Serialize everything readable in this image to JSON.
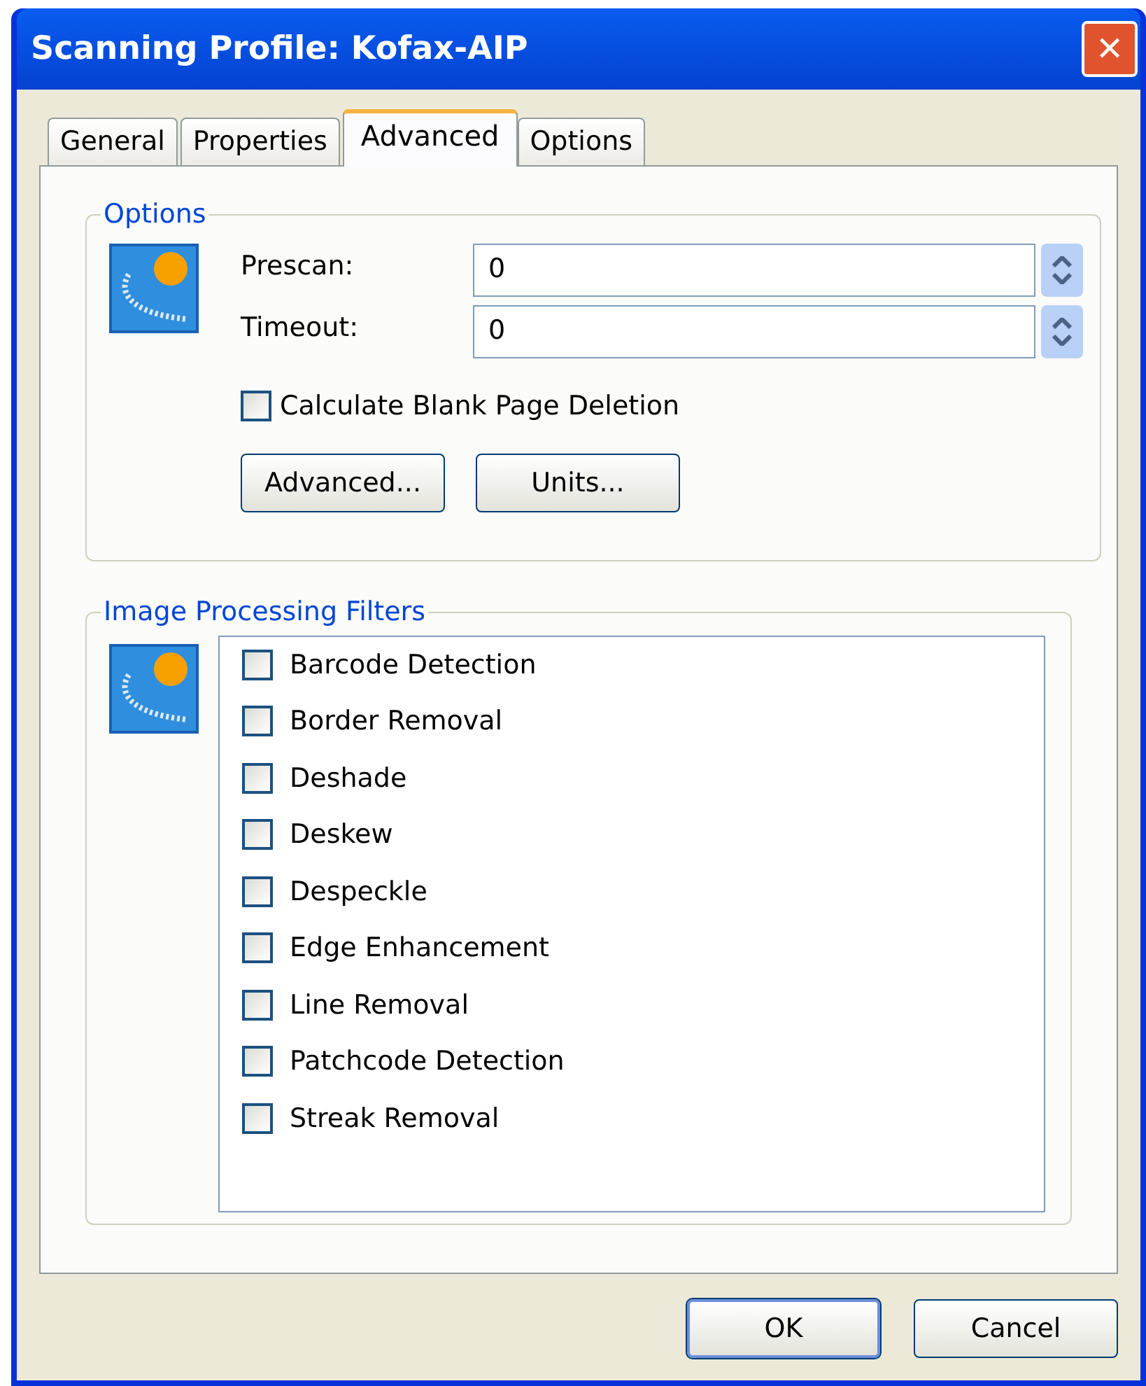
{
  "window": {
    "title": "Scanning Profile: Kofax-AIP",
    "close": "✕"
  },
  "tabs": [
    {
      "label": "General",
      "selected": false
    },
    {
      "label": "Properties",
      "selected": false
    },
    {
      "label": "Advanced",
      "selected": true
    },
    {
      "label": "Options",
      "selected": false
    }
  ],
  "options_group": {
    "title": "Options",
    "fields": [
      {
        "label": "Prescan:",
        "value": "0"
      },
      {
        "label": "Timeout:",
        "value": "0"
      }
    ],
    "checkbox": {
      "label": "Calculate Blank Page Deletion",
      "checked": false
    },
    "buttons": [
      "Advanced...",
      "Units..."
    ]
  },
  "filters_group": {
    "title": "Image Processing Filters",
    "items": [
      {
        "label": "Barcode Detection",
        "checked": false
      },
      {
        "label": "Border Removal",
        "checked": false
      },
      {
        "label": "Deshade",
        "checked": false
      },
      {
        "label": "Deskew",
        "checked": false
      },
      {
        "label": "Despeckle",
        "checked": false
      },
      {
        "label": "Edge Enhancement",
        "checked": false
      },
      {
        "label": "Line Removal",
        "checked": false
      },
      {
        "label": "Patchcode Detection",
        "checked": false
      },
      {
        "label": "Streak Removal",
        "checked": false
      }
    ]
  },
  "buttons": [
    {
      "label": "OK",
      "default": true
    },
    {
      "label": "Cancel",
      "default": false
    }
  ]
}
